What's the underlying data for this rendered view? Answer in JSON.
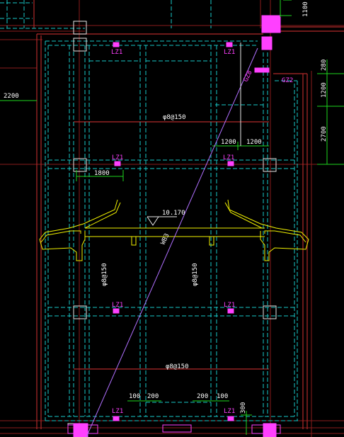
{
  "colors": {
    "background": "#000000",
    "axis_red": "#8a1c1c",
    "wall_red": "#b02a2a",
    "beam_cyan": "#19c9c9",
    "column_white": "#e8e8e8",
    "magenta": "#ff40ff",
    "slab_yellow": "#f0f000",
    "dim_green": "#1ed61e",
    "text_white": "#ffffff",
    "diag_violet": "#b070ff"
  },
  "column_labels": [
    "LZ1",
    "LZ1",
    "LZ1",
    "LZ1",
    "LZ1",
    "LZ1",
    "LZ1",
    "LZ1"
  ],
  "gz_labels": [
    "GZ8",
    "GZ2"
  ],
  "rebar_labels": [
    "φ8@150",
    "φ8@150",
    "φ8@150",
    "φ8@150"
  ],
  "elevation": "10.170",
  "diag_label": "WB3",
  "dims": {
    "left_2200": "2200",
    "top_1100": "1100",
    "right_280": "280",
    "right_1200": "1200",
    "right_2700": "2700",
    "mid_1200a": "1200",
    "mid_1200b": "1200",
    "span_1800": "1800",
    "bot_100a": "100",
    "bot_200a": "200",
    "bot_200b": "200",
    "bot_100b": "100",
    "bot_300": "300"
  }
}
